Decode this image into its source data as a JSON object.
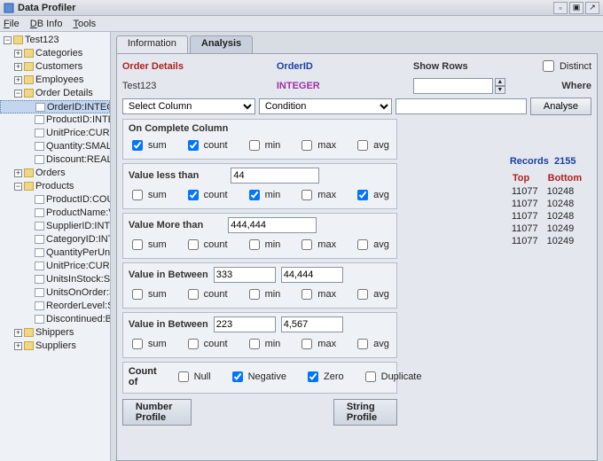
{
  "window": {
    "title": "Data Profiler"
  },
  "menu": {
    "file": "File",
    "dbinfo": "DB Info",
    "tools": "Tools"
  },
  "tree": {
    "root": "Test123",
    "categories": "Categories",
    "customers": "Customers",
    "employees": "Employees",
    "orderdetails": "Order Details",
    "od_orderid": "OrderID:INTEGER",
    "od_productid": "ProductID:INTEGE",
    "od_unitprice": "UnitPrice:CURREN",
    "od_quantity": "Quantity:SMALLINT",
    "od_discount": "Discount:REAL",
    "orders": "Orders",
    "products": "Products",
    "p_productid": "ProductID:COUNTE",
    "p_productname": "ProductName:VARC",
    "p_supplierid": "SupplierID:INTEGE",
    "p_categoryid": "CategoryID:INTEGE",
    "p_qtyperunit": "QuantityPerUnit:VAR",
    "p_unitprice": "UnitPrice:CURREN",
    "p_unitsinstock": "UnitsInStock:SMALL",
    "p_unitsonorder": "UnitsOnOrder:SMAL",
    "p_reorderlevel": "ReorderLevel:SMAL",
    "p_discontinued": "Discontinued:BIT",
    "shippers": "Shippers",
    "suppliers": "Suppliers"
  },
  "tabs": {
    "info": "Information",
    "analysis": "Analysis"
  },
  "header": {
    "orderdetails": "Order Details",
    "orderid": "OrderID",
    "showrows": "Show Rows",
    "distinct": "Distinct",
    "test123": "Test123",
    "integer": "INTEGER",
    "where": "Where",
    "selectcol": "Select Column",
    "condition": "Condition",
    "analyse": "Analyse",
    "showrows_val": ""
  },
  "groups": {
    "complete": "On Complete Column",
    "lessthan": "Value less than",
    "lessthan_val": "44",
    "morethan": "Value More than",
    "morethan_val": "444,444",
    "between1": "Value in Between",
    "between1_a": "333",
    "between1_b": "44,444",
    "between2": "Value in Between",
    "between2_a": "223",
    "between2_b": "4,567",
    "countof": "Count of"
  },
  "chklabels": {
    "sum": "sum",
    "count": "count",
    "min": "min",
    "max": "max",
    "avg": "avg",
    "null": "Null",
    "negative": "Negative",
    "zero": "Zero",
    "duplicate": "Duplicate"
  },
  "records": {
    "label": "Records",
    "value": "2155",
    "top": "Top",
    "bottom": "Bottom",
    "rows": [
      {
        "t": "11077",
        "b": "10248"
      },
      {
        "t": "11077",
        "b": "10248"
      },
      {
        "t": "11077",
        "b": "10248"
      },
      {
        "t": "11077",
        "b": "10249"
      },
      {
        "t": "11077",
        "b": "10249"
      }
    ]
  },
  "footer": {
    "number": "Number Profile",
    "string": "String Profile"
  }
}
